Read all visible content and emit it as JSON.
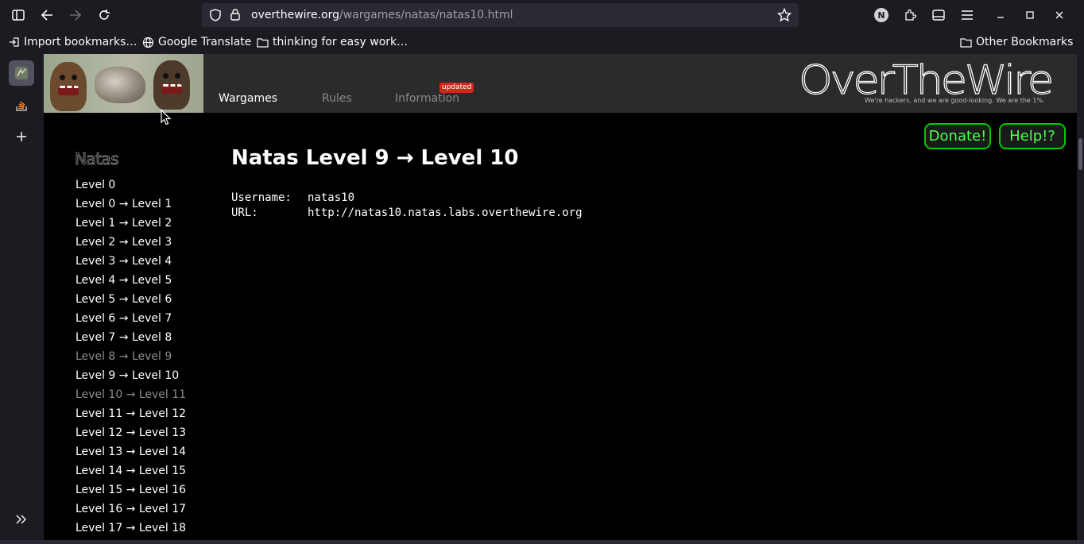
{
  "browser": {
    "url": {
      "host": "overthewire.org",
      "path": "/wargames/natas/natas10.html"
    },
    "bookmarks": [
      "Import bookmarks…",
      "Google Translate",
      "thinking for easy work…",
      "Other Bookmarks"
    ],
    "avatar_letter": "N"
  },
  "site": {
    "nav": [
      "Wargames",
      "Rules",
      "Information"
    ],
    "badge": "updated",
    "logo_text": "OverTheWire",
    "tagline": "We're hackers, and we are good-looking. We are the 1%.",
    "donate": "Donate!",
    "help": "Help!?"
  },
  "sidebar": {
    "title": "Natas",
    "levels": [
      {
        "label": "Level 0",
        "visited": false
      },
      {
        "label": "Level 0 → Level 1",
        "visited": false
      },
      {
        "label": "Level 1 → Level 2",
        "visited": false
      },
      {
        "label": "Level 2 → Level 3",
        "visited": false
      },
      {
        "label": "Level 3 → Level 4",
        "visited": false
      },
      {
        "label": "Level 4 → Level 5",
        "visited": false
      },
      {
        "label": "Level 5 → Level 6",
        "visited": false
      },
      {
        "label": "Level 6 → Level 7",
        "visited": false
      },
      {
        "label": "Level 7 → Level 8",
        "visited": false
      },
      {
        "label": "Level 8 → Level 9",
        "visited": true
      },
      {
        "label": "Level 9 → Level 10",
        "visited": false
      },
      {
        "label": "Level 10 → Level 11",
        "visited": true
      },
      {
        "label": "Level 11 → Level 12",
        "visited": false
      },
      {
        "label": "Level 12 → Level 13",
        "visited": false
      },
      {
        "label": "Level 13 → Level 14",
        "visited": false
      },
      {
        "label": "Level 14 → Level 15",
        "visited": false
      },
      {
        "label": "Level 15 → Level 16",
        "visited": false
      },
      {
        "label": "Level 16 → Level 17",
        "visited": false
      },
      {
        "label": "Level 17 → Level 18",
        "visited": false
      }
    ]
  },
  "content": {
    "title": "Natas Level 9 → Level 10",
    "username_label": "Username:",
    "username": "natas10",
    "url_label": "URL:",
    "url": "http://natas10.natas.labs.overthewire.org"
  },
  "colors": {
    "accent_green": "#4dff4d",
    "badge_red": "#d9241c"
  }
}
